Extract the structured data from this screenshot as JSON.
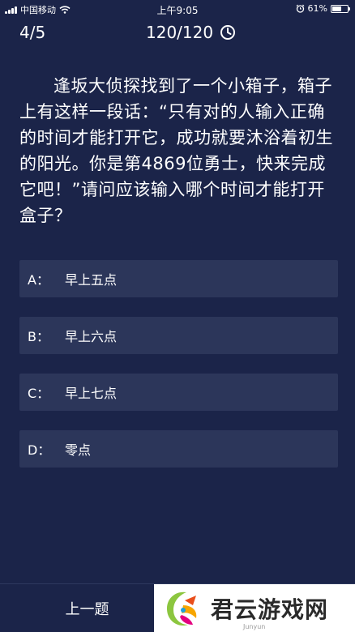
{
  "status_bar": {
    "carrier": "中国移动",
    "time": "上午9:05",
    "battery_percent": "61%",
    "battery_level": 0.61,
    "icons": [
      "signal-icon",
      "wifi-icon",
      "alarm-icon",
      "battery-icon"
    ]
  },
  "header": {
    "progress": "4/5",
    "score": "120/120",
    "timer_icon": "clock-icon"
  },
  "question": {
    "text": "逢坂大侦探找到了一个小箱子，箱子上有这样一段话：“只有对的人输入正确的时间才能打开它，成功就要沐浴着初生的阳光。你是第4869位勇士，快来完成它吧！”请问应该输入哪个时间才能打开盒子？"
  },
  "options": [
    {
      "letter": "A：",
      "text": "早上五点"
    },
    {
      "letter": "B：",
      "text": "早上六点"
    },
    {
      "letter": "C：",
      "text": "早上七点"
    },
    {
      "letter": "D：",
      "text": "零点"
    }
  ],
  "footer": {
    "prev_label": "上一题"
  },
  "watermark": {
    "text": "君云游戏网",
    "domain": "Junyun"
  },
  "colors": {
    "background": "#1b2449",
    "option_bg": "#2c365a",
    "text": "#ffffff"
  }
}
